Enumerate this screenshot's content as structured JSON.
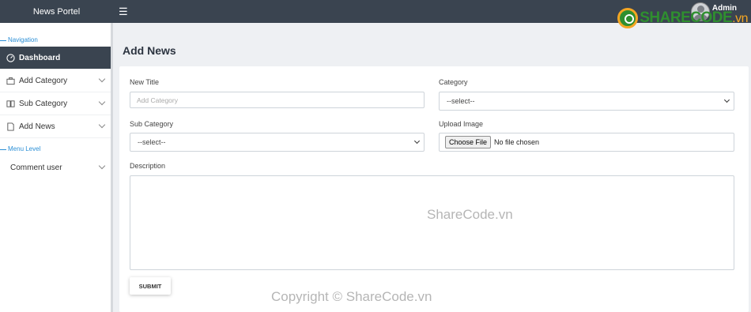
{
  "topbar": {
    "brand": "News Portel",
    "menu_icon": "hamburger-icon",
    "user_name": "Admin",
    "logo_text": "SHARECODE",
    "logo_suffix": ".vn"
  },
  "sidebar": {
    "section_navigation": "Navigation",
    "items": [
      {
        "label": "Dashboard",
        "icon": "dashboard-icon",
        "active": true
      },
      {
        "label": "Add Category",
        "icon": "briefcase-icon"
      },
      {
        "label": "Sub Category",
        "icon": "book-icon"
      },
      {
        "label": "Add News",
        "icon": "document-icon"
      }
    ],
    "section_menu": "Menu Level",
    "comment_item": "Comment user"
  },
  "main": {
    "title": "Add News",
    "form": {
      "new_title_label": "New Title",
      "new_title_placeholder": "Add Category",
      "category_label": "Category",
      "category_value": "--select--",
      "sub_category_label": "Sub Category",
      "sub_category_value": "--select--",
      "upload_label": "Upload Image",
      "choose_file": "Choose File",
      "no_file": "No file chosen",
      "description_label": "Description",
      "submit": "SUBMIT"
    }
  },
  "watermarks": {
    "center": "ShareCode.vn",
    "bottom": "Copyright © ShareCode.vn"
  }
}
